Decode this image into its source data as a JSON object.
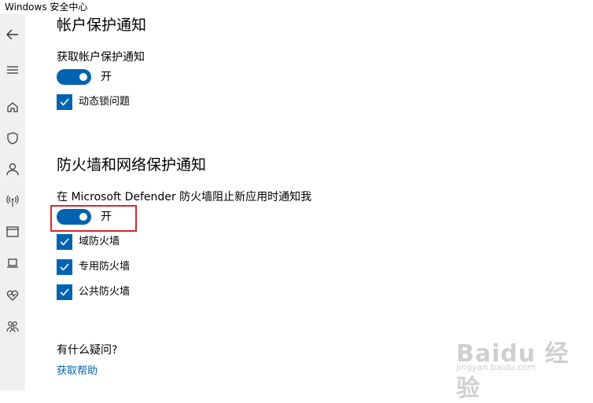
{
  "window": {
    "title": "Windows 安全中心"
  },
  "sidebar": {
    "items": [
      {
        "icon": "back-arrow-icon"
      },
      {
        "icon": "hamburger-menu-icon"
      },
      {
        "icon": "home-icon"
      },
      {
        "icon": "shield-icon"
      },
      {
        "icon": "person-icon"
      },
      {
        "icon": "wireless-signal-icon"
      },
      {
        "icon": "browser-window-icon"
      },
      {
        "icon": "laptop-icon"
      },
      {
        "icon": "heart-pulse-icon"
      },
      {
        "icon": "family-icon"
      }
    ]
  },
  "account_section": {
    "title": "帐户保护通知",
    "setting_label": "获取帐户保护通知",
    "toggle_state": "开",
    "toggle_on": true,
    "checkbox_label": "动态锁问题",
    "checkbox_checked": true
  },
  "firewall_section": {
    "title": "防火墙和网络保护通知",
    "setting_label": "在 Microsoft Defender 防火墙阻止新应用时通知我",
    "toggle_state": "开",
    "toggle_on": true,
    "checkboxes": [
      {
        "label": "域防火墙",
        "checked": true
      },
      {
        "label": "专用防火墙",
        "checked": true
      },
      {
        "label": "公共防火墙",
        "checked": true
      }
    ]
  },
  "help": {
    "question": "有什么疑问?",
    "link": "获取帮助"
  },
  "watermark": {
    "main": "Baidu 经验",
    "sub": "jingyan.baidu.com"
  },
  "colors": {
    "accent": "#0063b1",
    "highlight": "#d9262c",
    "sidebar_bg": "#f0f0f0"
  }
}
